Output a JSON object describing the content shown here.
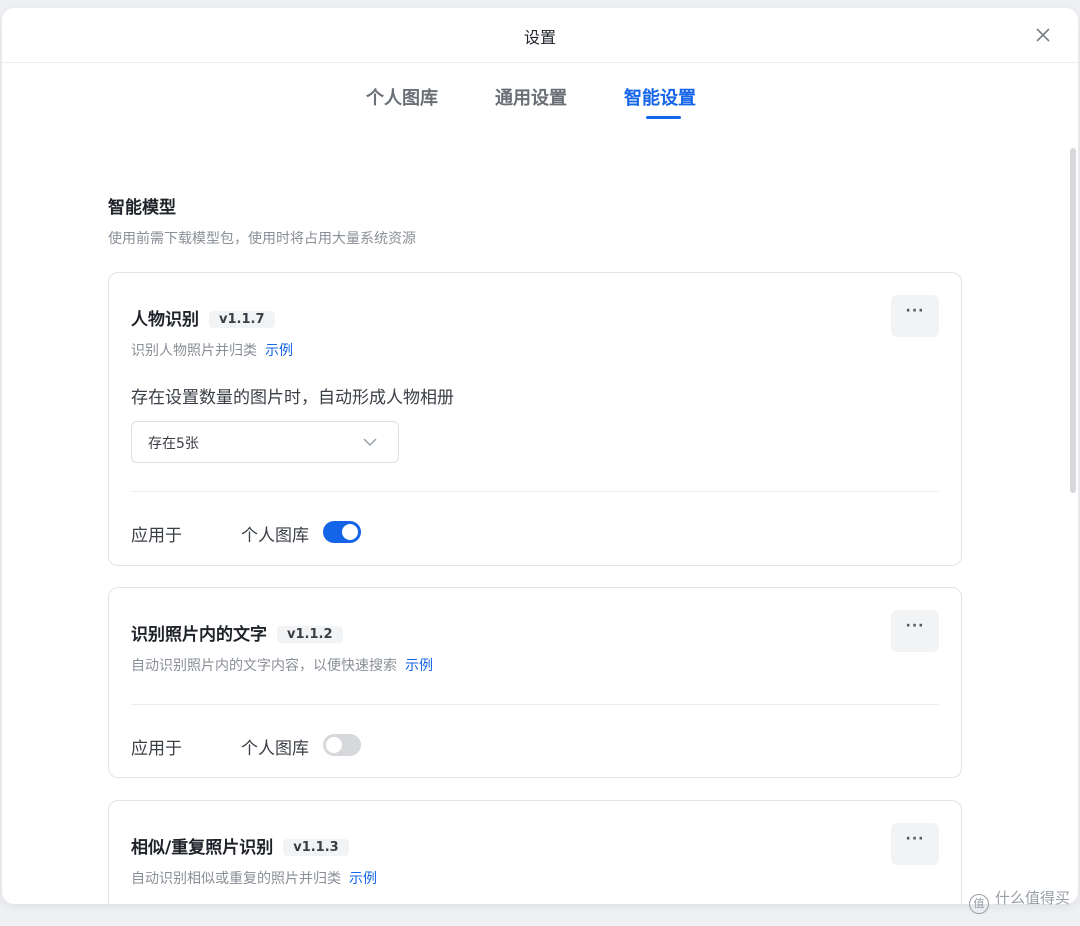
{
  "window": {
    "title": "设置",
    "close_icon": "close-icon"
  },
  "tabs": [
    {
      "label": "个人图库",
      "active": false
    },
    {
      "label": "通用设置",
      "active": false
    },
    {
      "label": "智能设置",
      "active": true
    }
  ],
  "colors": {
    "accent": "#1565e8",
    "text": "#1f2329",
    "muted": "#8a8f97"
  },
  "section": {
    "title": "智能模型",
    "description": "使用前需下载模型包，使用时将占用大量系统资源"
  },
  "cards": [
    {
      "title": "人物识别",
      "version": "v1.1.7",
      "description": "识别人物照片并归类",
      "example_link": "示例",
      "more_icon": "more-horizontal-icon",
      "more_label": "···",
      "rule_text": "存在设置数量的图片时，自动形成人物相册",
      "select_value": "存在5张",
      "apply_label": "应用于",
      "apply_target": "个人图库",
      "enabled": true
    },
    {
      "title": "识别照片内的文字",
      "version": "v1.1.2",
      "description": "自动识别照片内的文字内容，以便快速搜索",
      "example_link": "示例",
      "more_icon": "more-horizontal-icon",
      "more_label": "···",
      "apply_label": "应用于",
      "apply_target": "个人图库",
      "enabled": false
    },
    {
      "title": "相似/重复照片识别",
      "version": "v1.1.3",
      "description": "自动识别相似或重复的照片并归类",
      "example_link": "示例",
      "more_icon": "more-horizontal-icon",
      "more_label": "···"
    }
  ],
  "watermark": {
    "icon": "值",
    "text": "什么值得买"
  }
}
